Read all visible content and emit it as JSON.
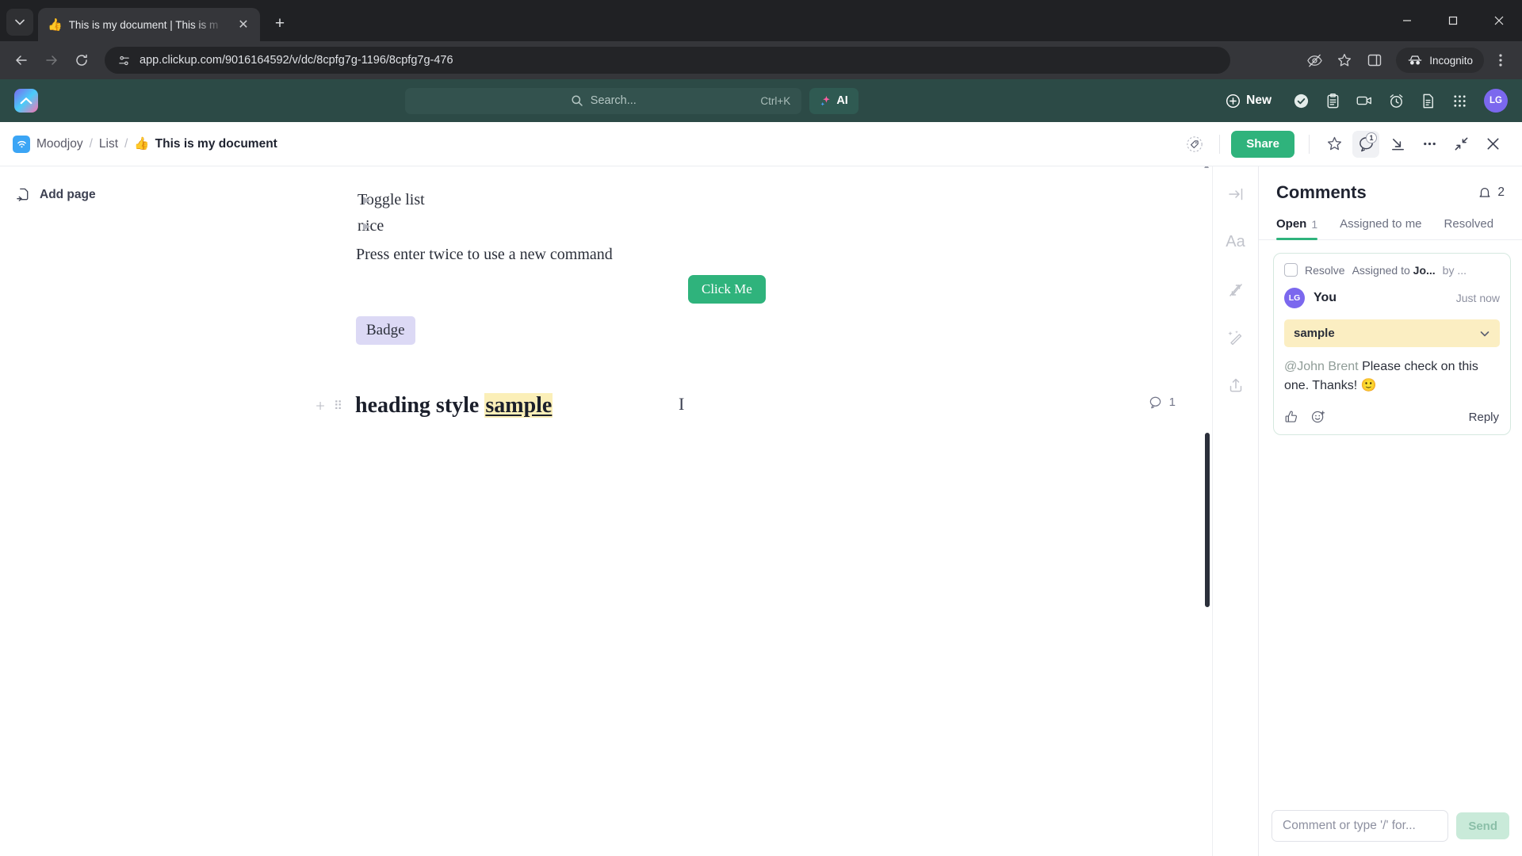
{
  "browser": {
    "tab": {
      "favicon": "thumbs-up-emoji",
      "title": "This is my document | This is m",
      "close_label": "✕"
    },
    "new_tab_label": "+",
    "window_controls": {
      "minimize": "─",
      "maximize": "☐",
      "close": "✕"
    },
    "toolbar": {
      "back": "←",
      "forward": "→",
      "reload": "↻",
      "url": "app.clickup.com/9016164592/v/dc/8cpfg7g-1196/8cpfg7g-476",
      "site_info_icon": "tune-icon",
      "incognito_label": "Incognito"
    }
  },
  "clickup_bar": {
    "logo_glyph": "⟲",
    "search": {
      "placeholder": "Search...",
      "shortcut": "Ctrl+K"
    },
    "ai_label": "AI",
    "new_label": "New",
    "icons": [
      "check-circle-icon",
      "clipboard-icon",
      "video-camera-icon",
      "alarm-clock-icon",
      "document-icon",
      "apps-grid-icon"
    ],
    "avatar_initials": "LG"
  },
  "doc_header": {
    "breadcrumb": {
      "workspace": "Moodjoy",
      "sep": "/",
      "list": "List",
      "doc_emoji": "👍",
      "doc_title": "This is my document"
    },
    "share_label": "Share",
    "comment_badge": "1",
    "icons": [
      "tag-icon",
      "star-icon",
      "comment-icon",
      "import-icon",
      "more-options-icon",
      "collapse-icon",
      "close-icon"
    ]
  },
  "doc_sidebar": {
    "add_page_label": "Add page"
  },
  "document": {
    "toggle_items": [
      "Toggle list",
      "nice"
    ],
    "paragraph": "Press enter twice to use a new command",
    "button_label": "Click Me",
    "badge_label": "Badge",
    "heading": {
      "plain": "heading style ",
      "highlighted": "sample"
    },
    "heading_comment_count": "1"
  },
  "tool_rail": {
    "icons": [
      "collapse-right-icon",
      "font-size-icon",
      "relationships-icon",
      "ai-wand-icon",
      "share-upload-icon"
    ],
    "font_label": "Aa"
  },
  "comments": {
    "title": "Comments",
    "notification_count": "2",
    "tabs": [
      {
        "label": "Open",
        "count": "1",
        "active": true
      },
      {
        "label": "Assigned to me",
        "count": "",
        "active": false
      },
      {
        "label": "Resolved",
        "count": "",
        "active": false
      }
    ],
    "card": {
      "resolve_label": "Resolve",
      "assigned_label": "Assigned to",
      "assigned_to": "Jo...",
      "by_label": "by ...",
      "avatar_initials": "LG",
      "author": "You",
      "time": "Just now",
      "quote": "sample",
      "mention": "@John Brent",
      "text": " Please check on this one. Thanks! 🙂",
      "like_icon": "thumbs-up-icon",
      "emoji_icon": "add-reaction-icon",
      "reply_label": "Reply"
    },
    "composer": {
      "placeholder": "Comment or type '/' for...",
      "send_label": "Send"
    }
  },
  "colors": {
    "clickup_green": "#2fb37c",
    "topbar_dark_green": "#2c4a46",
    "highlight_yellow": "#fbefb8",
    "badge_purple": "#dcd9f5",
    "avatar_purple": "#7b68ee"
  }
}
